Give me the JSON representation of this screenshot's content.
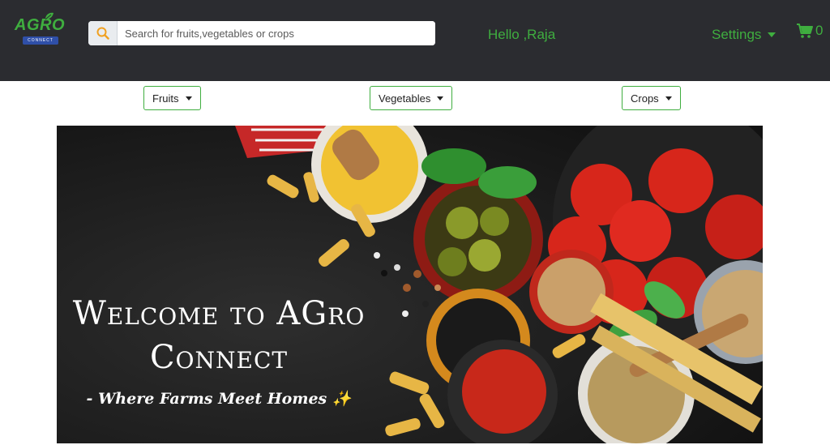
{
  "brand": {
    "logo_text": "AGRO",
    "logo_sub": "CONNECT"
  },
  "search": {
    "placeholder": "Search for fruits,vegetables or crops",
    "value": ""
  },
  "header": {
    "greeting": "Hello ,Raja",
    "settings_label": "Settings",
    "cart_count": "0"
  },
  "categories": [
    {
      "label": "Fruits"
    },
    {
      "label": "Vegetables"
    },
    {
      "label": "Crops"
    }
  ],
  "hero": {
    "title": "Welcome to AGro Connect",
    "tagline": "- Where Farms Meet Homes",
    "tagline_emoji": "✨"
  },
  "colors": {
    "navbar": "#2b2c30",
    "accent": "#3fae3f",
    "search_icon": "#f0a020"
  },
  "icons": [
    "leaf-icon",
    "search-icon",
    "caret-down-icon",
    "cart-icon"
  ]
}
